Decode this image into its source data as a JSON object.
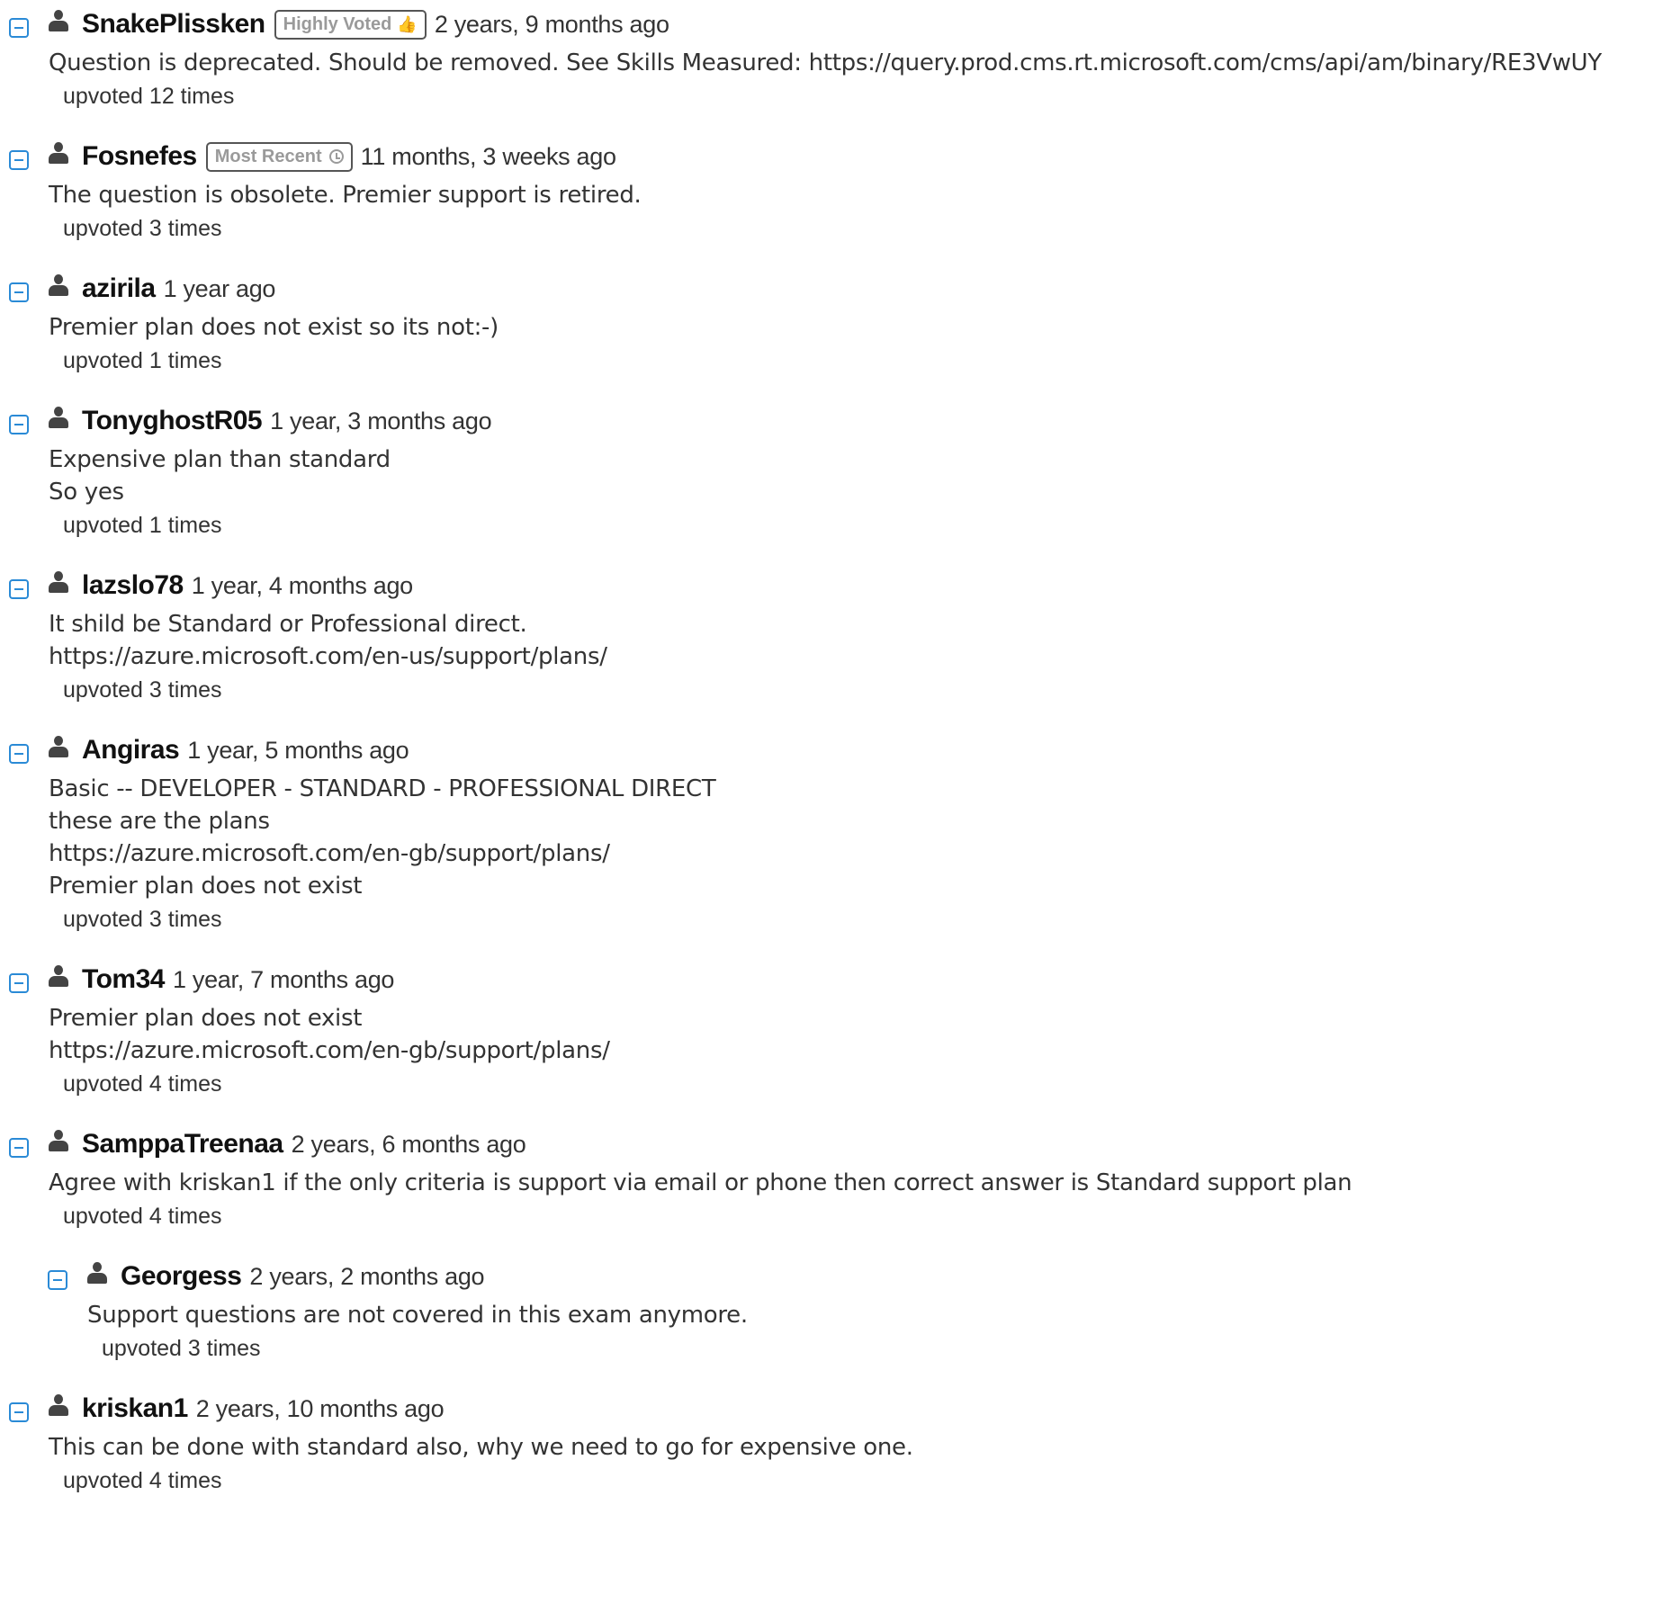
{
  "comments": [
    {
      "username": "SnakePlissken",
      "badge": "Highly Voted",
      "badge_icon": "thumbs-up-icon",
      "time": "2 years, 9 months ago",
      "text": "Question is deprecated. Should be removed. See Skills Measured: https://query.prod.cms.rt.microsoft.com/cms/api/am/binary/RE3VwUY",
      "upvotes": "upvoted 12 times"
    },
    {
      "username": "Fosnefes",
      "badge": "Most Recent",
      "badge_icon": "clock-icon",
      "time": "11 months, 3 weeks ago",
      "text": "The question is obsolete. Premier support is retired.",
      "upvotes": "upvoted 3 times"
    },
    {
      "username": "azirila",
      "time": "1 year ago",
      "text": "Premier plan does not exist so its not:-)",
      "upvotes": "upvoted 1 times"
    },
    {
      "username": "TonyghostR05",
      "time": "1 year, 3 months ago",
      "text": "Expensive plan than standard\nSo yes",
      "upvotes": "upvoted 1 times"
    },
    {
      "username": "lazslo78",
      "time": "1 year, 4 months ago",
      "text": "It shild be Standard or Professional direct.\nhttps://azure.microsoft.com/en-us/support/plans/",
      "upvotes": "upvoted 3 times"
    },
    {
      "username": "Angiras",
      "time": "1 year, 5 months ago",
      "text": "Basic -- DEVELOPER - STANDARD - PROFESSIONAL DIRECT\nthese are the plans\nhttps://azure.microsoft.com/en-gb/support/plans/\nPremier plan does not exist",
      "upvotes": "upvoted 3 times"
    },
    {
      "username": "Tom34",
      "time": "1 year, 7 months ago",
      "text": "Premier plan does not exist\nhttps://azure.microsoft.com/en-gb/support/plans/",
      "upvotes": "upvoted 4 times"
    },
    {
      "username": "SamppaTreenaa",
      "time": "2 years, 6 months ago",
      "text": "Agree with kriskan1 if the only criteria is support via email or phone then correct answer is Standard support plan",
      "upvotes": "upvoted 4 times"
    },
    {
      "username": "Georgess",
      "time": "2 years, 2 months ago",
      "text": "Support questions are not covered in this exam anymore.",
      "upvotes": "upvoted 3 times",
      "reply": true
    },
    {
      "username": "kriskan1",
      "time": "2 years, 10 months ago",
      "text": "This can be done with standard also, why we need to go for expensive one.",
      "upvotes": "upvoted 4 times"
    }
  ],
  "colors": {
    "toggle": "#2a8ad6",
    "text": "#333333",
    "badge_text": "#9a9a9a"
  }
}
